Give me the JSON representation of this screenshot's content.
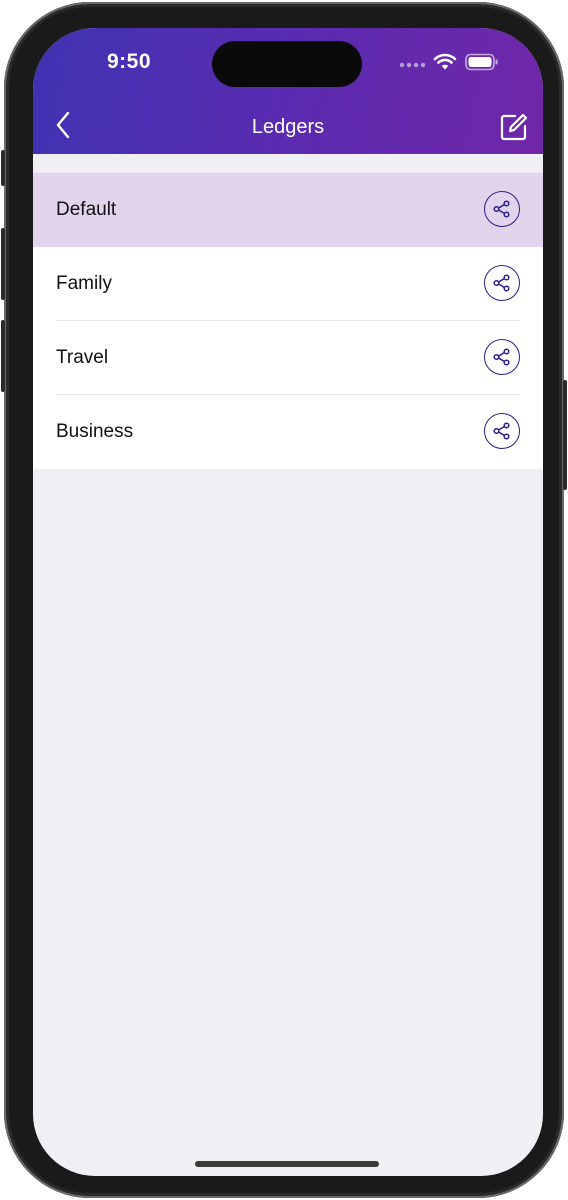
{
  "status_bar": {
    "time": "9:50",
    "icons": [
      "signal-dots-icon",
      "wifi-icon",
      "battery-icon"
    ]
  },
  "nav": {
    "title": "Ledgers",
    "back_icon": "chevron-left-icon",
    "edit_icon": "compose-icon"
  },
  "ledgers": [
    {
      "label": "Default",
      "selected": true,
      "icon": "share-icon"
    },
    {
      "label": "Family",
      "selected": false,
      "icon": "share-icon"
    },
    {
      "label": "Travel",
      "selected": false,
      "icon": "share-icon"
    },
    {
      "label": "Business",
      "selected": false,
      "icon": "share-icon"
    }
  ],
  "colors": {
    "header_start": "#3f33b3",
    "header_end": "#7027a8",
    "selected_row": "#e2d4ec",
    "icon_accent": "#2a1f8a",
    "background": "#f0eff4"
  }
}
